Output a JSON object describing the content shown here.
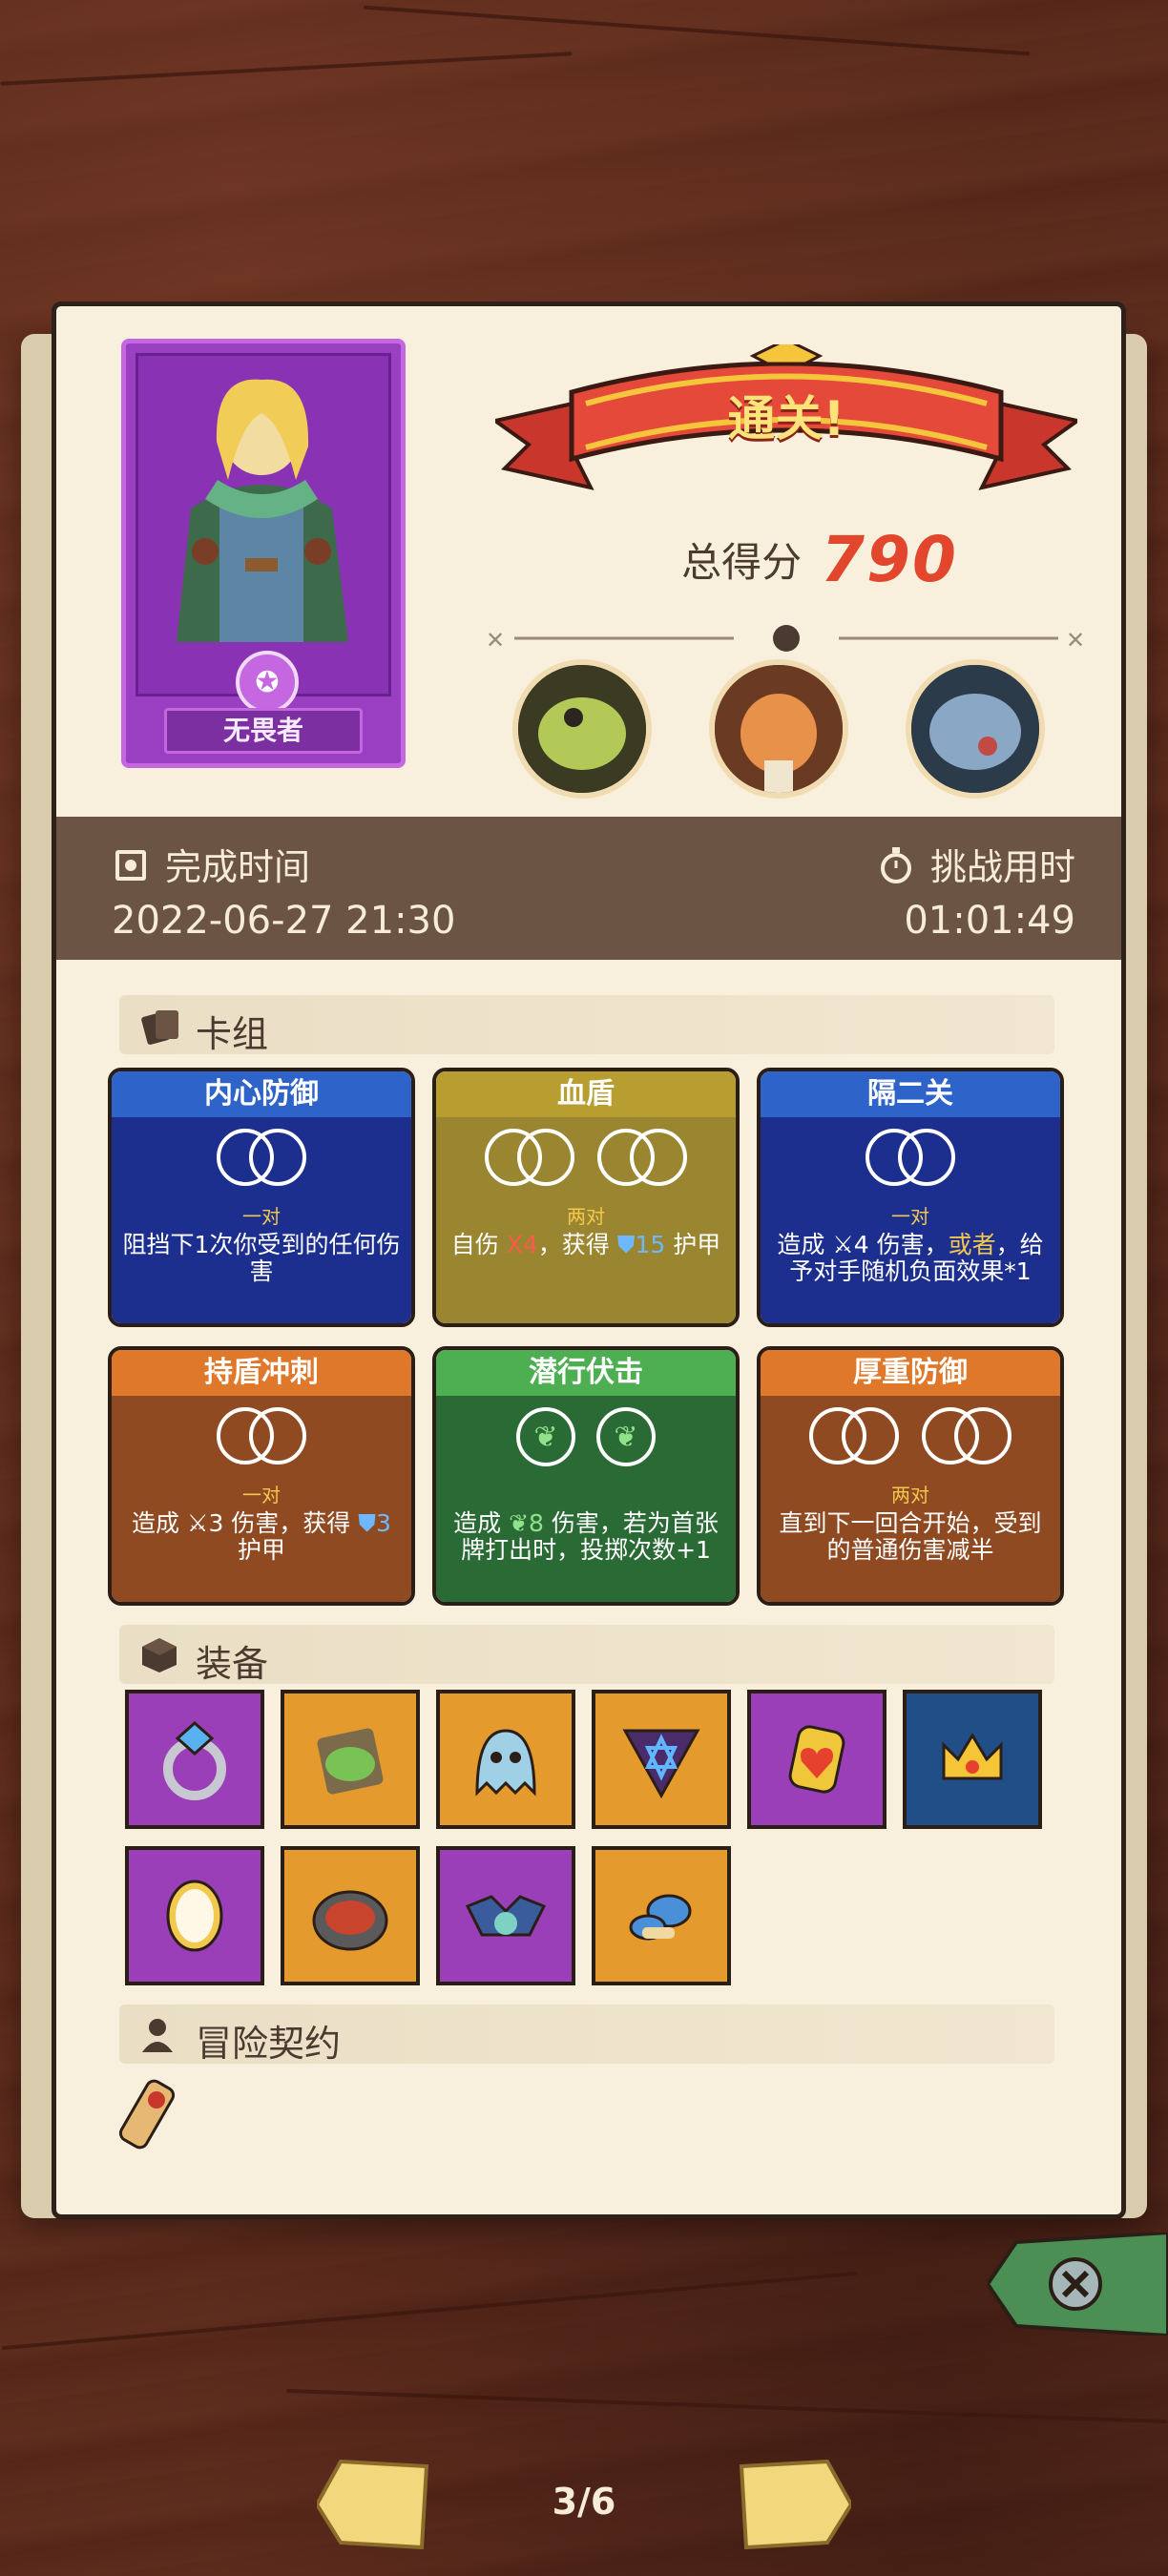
{
  "hero": {
    "name": "无畏者"
  },
  "result": {
    "banner": "通关!",
    "score_label": "总得分",
    "score_value": "790"
  },
  "bosses": [
    "lizard-skeleton-boss",
    "horned-warrior-boss",
    "rhino-boss"
  ],
  "time": {
    "finish_label": "完成时间",
    "finish_value": "2022-06-27 21:30",
    "duration_label": "挑战用时",
    "duration_value": "01:01:49"
  },
  "deck": {
    "title": "卡组",
    "cards": [
      {
        "name": "内心防御",
        "count": "一对",
        "desc": "阻挡下1次你受到的任何伤害",
        "color": "blue"
      },
      {
        "name": "血盾",
        "count": "两对",
        "desc_pre": "自伤",
        "desc_red": "X4",
        "desc_mid": "，获得",
        "desc_blue": "15",
        "desc_post": "护甲",
        "color": "olive"
      },
      {
        "name": "隔二关",
        "count": "一对",
        "desc_pre": "造成",
        "desc_white": "4",
        "desc_mid": "伤害，",
        "desc_yellow": "或者",
        "desc_post": "，给予对手随机负面效果*1",
        "color": "blue"
      },
      {
        "name": "持盾冲刺",
        "count": "一对",
        "desc_pre": "造成",
        "desc_white": "3",
        "desc_mid": "伤害，获得",
        "desc_blue": "3",
        "desc_post": "护甲",
        "color": "orange"
      },
      {
        "name": "潜行伏击",
        "count": "",
        "desc_pre": "造成",
        "desc_green": "8",
        "desc_post": "伤害，若为首张牌打出时，投掷次数+1",
        "color": "green"
      },
      {
        "name": "厚重防御",
        "count": "两对",
        "desc": "直到下一回合开始，受到的普通伤害减半",
        "color": "orange"
      }
    ]
  },
  "equipment": {
    "title": "装备",
    "items": [
      {
        "icon": "crystal-ring-icon",
        "bg": "purple"
      },
      {
        "icon": "mossy-stone-icon",
        "bg": "orange"
      },
      {
        "icon": "ghost-slime-icon",
        "bg": "orange"
      },
      {
        "icon": "star-triangle-icon",
        "bg": "orange"
      },
      {
        "icon": "heart-gem-icon",
        "bg": "purple"
      },
      {
        "icon": "gold-crown-icon",
        "bg": "navy"
      },
      {
        "icon": "mirror-icon",
        "bg": "purple"
      },
      {
        "icon": "fire-pot-icon",
        "bg": "orange"
      },
      {
        "icon": "bat-pet-icon",
        "bg": "purple"
      },
      {
        "icon": "blue-mushroom-icon",
        "bg": "orange"
      }
    ]
  },
  "contract": {
    "title": "冒险契约"
  },
  "pager": {
    "indicator": "3/6"
  }
}
